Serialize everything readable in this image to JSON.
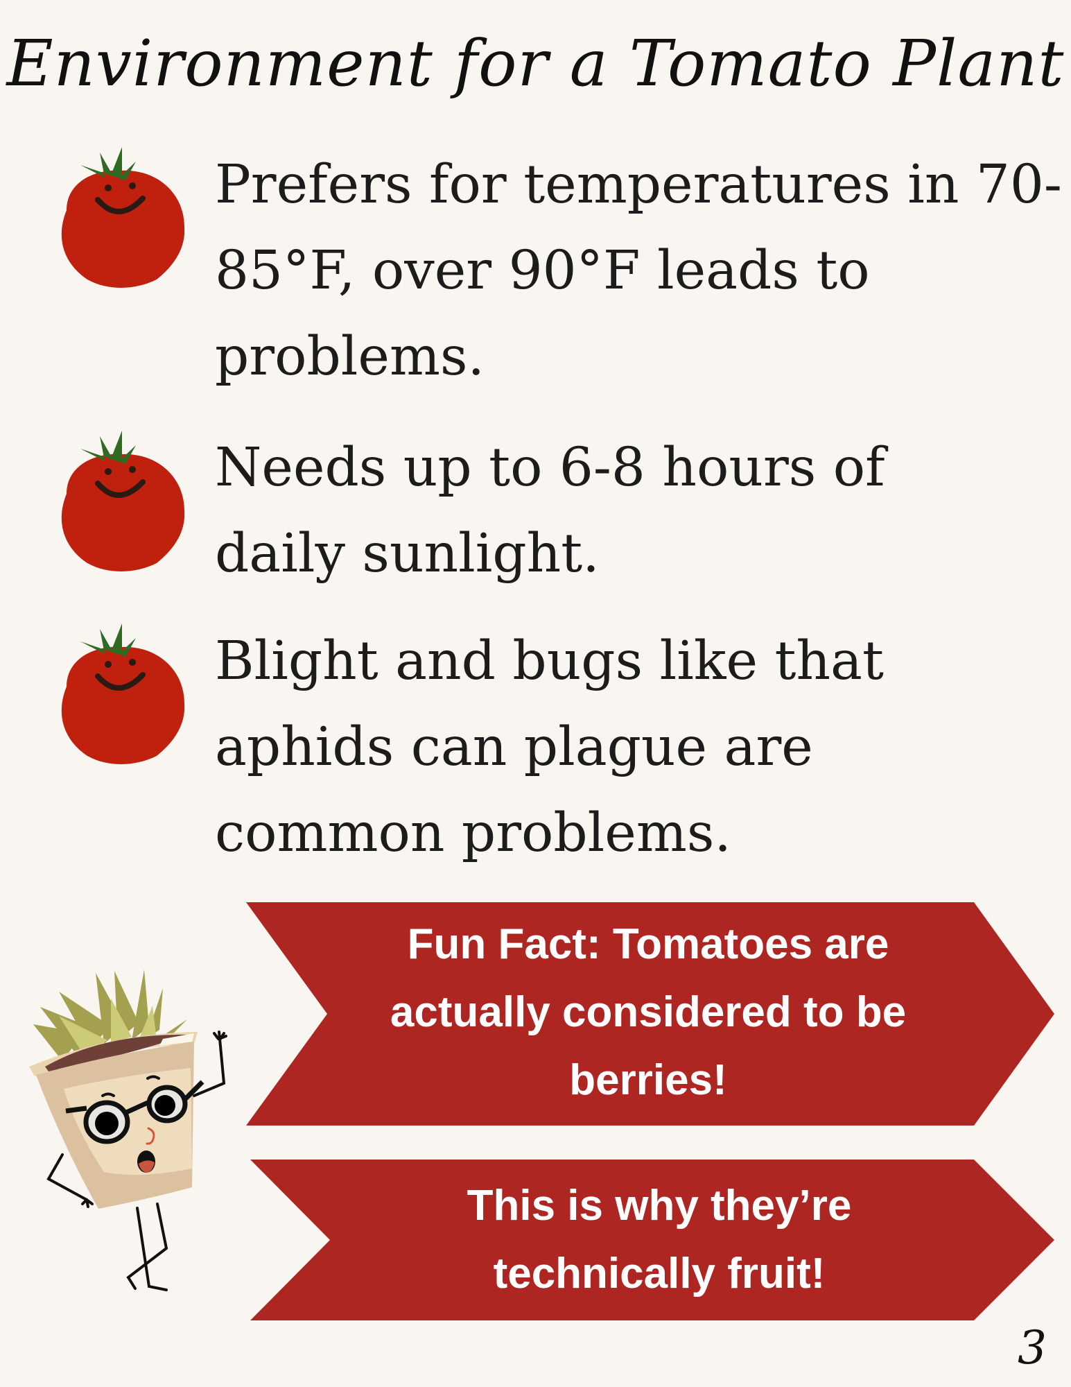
{
  "title": "Environment for a Tomato Plant",
  "points": [
    {
      "text": "Prefers for temperatures in 70-85°F, over 90°F leads to problems.",
      "icon": "smiling-tomato-icon"
    },
    {
      "text": "Needs up to 6-8 hours of daily sunlight.",
      "icon": "smiling-tomato-icon"
    },
    {
      "text": "Blight and bugs like that aphids can plague are common problems.",
      "icon": "smiling-tomato-icon"
    }
  ],
  "fun_fact": {
    "banner1": "Fun Fact: Tomatoes are actually considered to be berries!",
    "banner2": "This is why they’re technically fruit!"
  },
  "page_number": "3",
  "colors": {
    "background": "#f9f5f0",
    "banner": "#ae2622",
    "tomato": "#c0200e",
    "stem": "#2f6b22"
  }
}
